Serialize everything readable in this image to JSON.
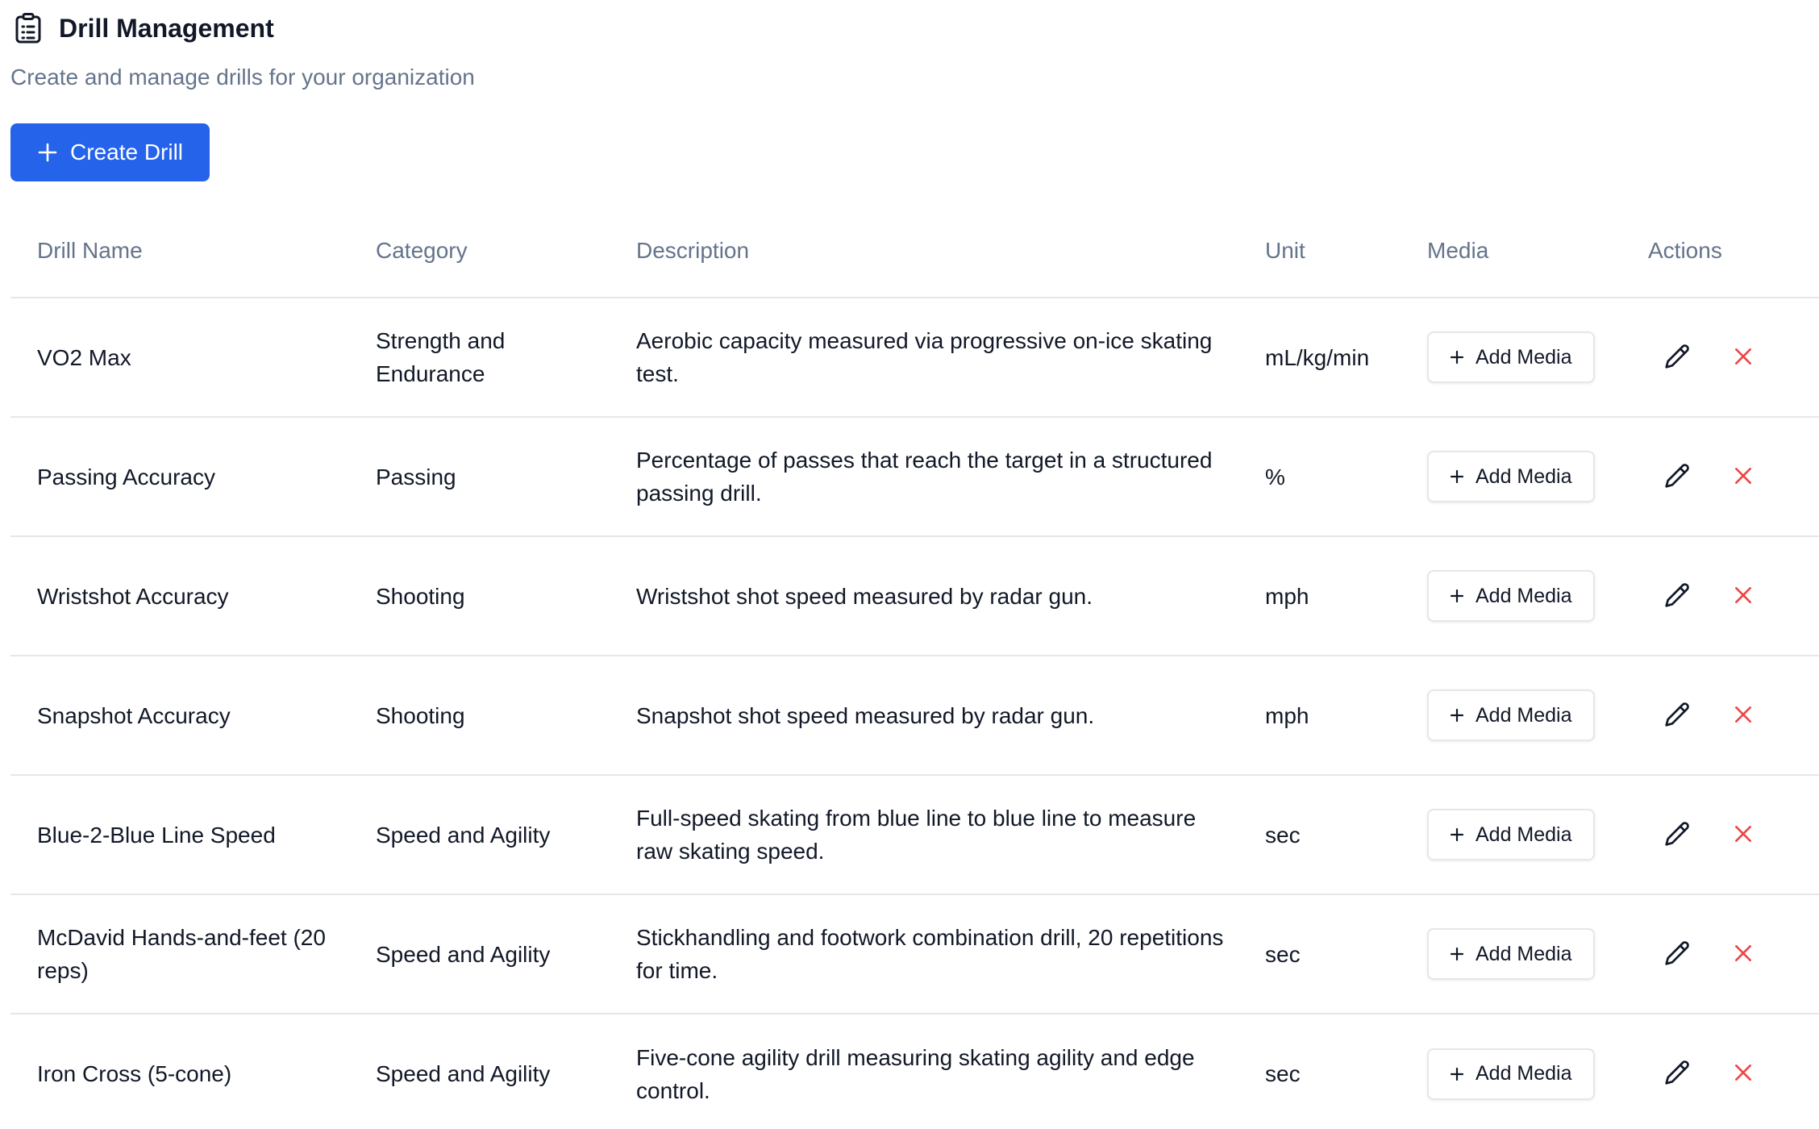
{
  "header": {
    "title": "Drill Management",
    "subtitle": "Create and manage drills for your organization",
    "icon": "clipboard-list-icon"
  },
  "toolbar": {
    "create_label": "Create Drill"
  },
  "table": {
    "columns": [
      "Drill Name",
      "Category",
      "Description",
      "Unit",
      "Media",
      "Actions"
    ],
    "add_media_label": "Add Media",
    "rows": [
      {
        "name": "VO2 Max",
        "category": "Strength and Endurance",
        "description": "Aerobic capacity measured via progressive on-ice skating test.",
        "unit": "mL/kg/min"
      },
      {
        "name": "Passing Accuracy",
        "category": "Passing",
        "description": "Percentage of passes that reach the target in a structured passing drill.",
        "unit": "%"
      },
      {
        "name": "Wristshot Accuracy",
        "category": "Shooting",
        "description": "Wristshot shot speed measured by radar gun.",
        "unit": "mph"
      },
      {
        "name": "Snapshot Accuracy",
        "category": "Shooting",
        "description": "Snapshot shot speed measured by radar gun.",
        "unit": "mph"
      },
      {
        "name": "Blue-2-Blue Line Speed",
        "category": "Speed and Agility",
        "description": "Full-speed skating from blue line to blue line to measure raw skating speed.",
        "unit": "sec"
      },
      {
        "name": "McDavid Hands-and-feet (20 reps)",
        "category": "Speed and Agility",
        "description": "Stickhandling and footwork combination drill, 20 repetitions for time.",
        "unit": "sec"
      },
      {
        "name": "Iron Cross (5-cone)",
        "category": "Speed and Agility",
        "description": "Five-cone agility drill measuring skating agility and edge control.",
        "unit": "sec"
      }
    ]
  },
  "colors": {
    "primary": "#2563eb",
    "delete": "#ef4444",
    "muted_text": "#64748b",
    "border": "#e5e7eb"
  }
}
